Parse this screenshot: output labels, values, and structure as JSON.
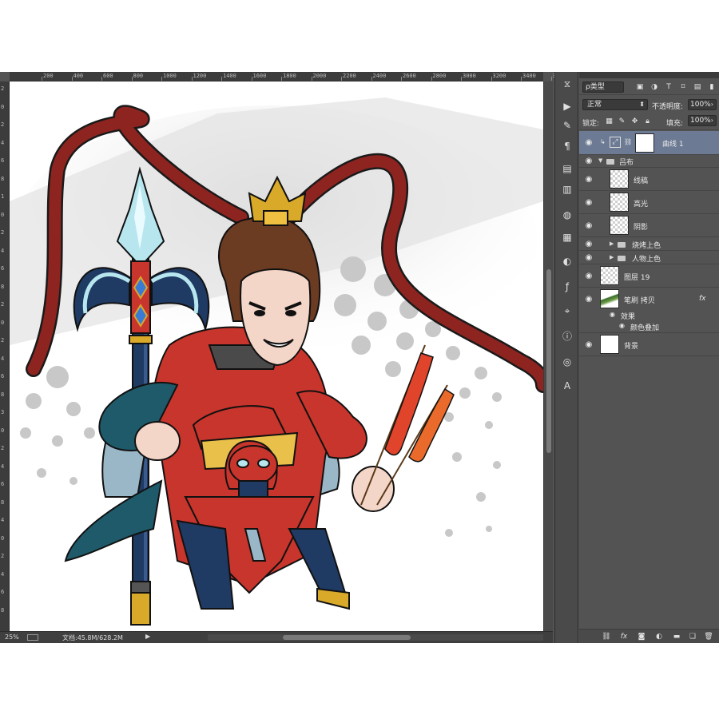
{
  "ruler": {
    "ticks": [
      "200",
      "400",
      "600",
      "800",
      "1000",
      "1200",
      "1400",
      "1600",
      "1800",
      "2000",
      "2200",
      "2400",
      "2600",
      "2800",
      "3000",
      "3200",
      "3400",
      "3600"
    ],
    "vertical_ticks": [
      "2",
      "0",
      "2",
      "4",
      "6",
      "8",
      "1",
      "0",
      "2",
      "4",
      "6",
      "8",
      "2",
      "0",
      "2",
      "4",
      "6",
      "8",
      "3",
      "0",
      "2",
      "4",
      "6",
      "8",
      "4",
      "0",
      "2",
      "4",
      "6",
      "8"
    ]
  },
  "status": {
    "zoom": "25%",
    "doc_info": "文档:45.8M/628.2M",
    "arrow": "▶"
  },
  "layers_panel": {
    "filter_label": "ρ类型",
    "blend_mode": "正常",
    "opacity_label": "不透明度:",
    "opacity_value": "100%",
    "lock_label": "锁定:",
    "fill_label": "填充:",
    "fill_value": "100%",
    "layers": [
      {
        "name": "曲线 1",
        "kind": "adjustment",
        "selected": true
      },
      {
        "name": "吕布",
        "kind": "group-open"
      },
      {
        "name": "线稿",
        "kind": "layer"
      },
      {
        "name": "高光",
        "kind": "layer"
      },
      {
        "name": "阴影",
        "kind": "layer"
      },
      {
        "name": "烧烤上色",
        "kind": "group"
      },
      {
        "name": "人物上色",
        "kind": "group"
      },
      {
        "name": "图层 19",
        "kind": "layer"
      },
      {
        "name": "笔刷 拷贝",
        "kind": "layer",
        "fx": "fx"
      },
      {
        "name": "效果",
        "kind": "effect"
      },
      {
        "name": "颜色叠加",
        "kind": "effect-item"
      },
      {
        "name": "背景",
        "kind": "background"
      }
    ],
    "bottom_icons": [
      "link-icon",
      "fx-icon",
      "mask-icon",
      "adjustment-icon",
      "folder-icon",
      "new-layer-icon",
      "trash-icon"
    ]
  },
  "icon_strip": [
    "history-icon",
    "actions-icon",
    "brush-icon",
    "paragraph-icon",
    "character-icon",
    "paths-icon",
    "notes-icon",
    "swatches-icon",
    "grid-icon",
    "color-icon",
    "styles-icon",
    "navigator-icon",
    "info-icon",
    "channels-icon",
    "text-icon"
  ],
  "colors": {
    "workspace": "#535353",
    "selected_layer": "#6c7a94",
    "ribbon": "#8e2420",
    "armor_red": "#c8352c",
    "armor_navy": "#1f3a63",
    "gold": "#d9a92a"
  }
}
